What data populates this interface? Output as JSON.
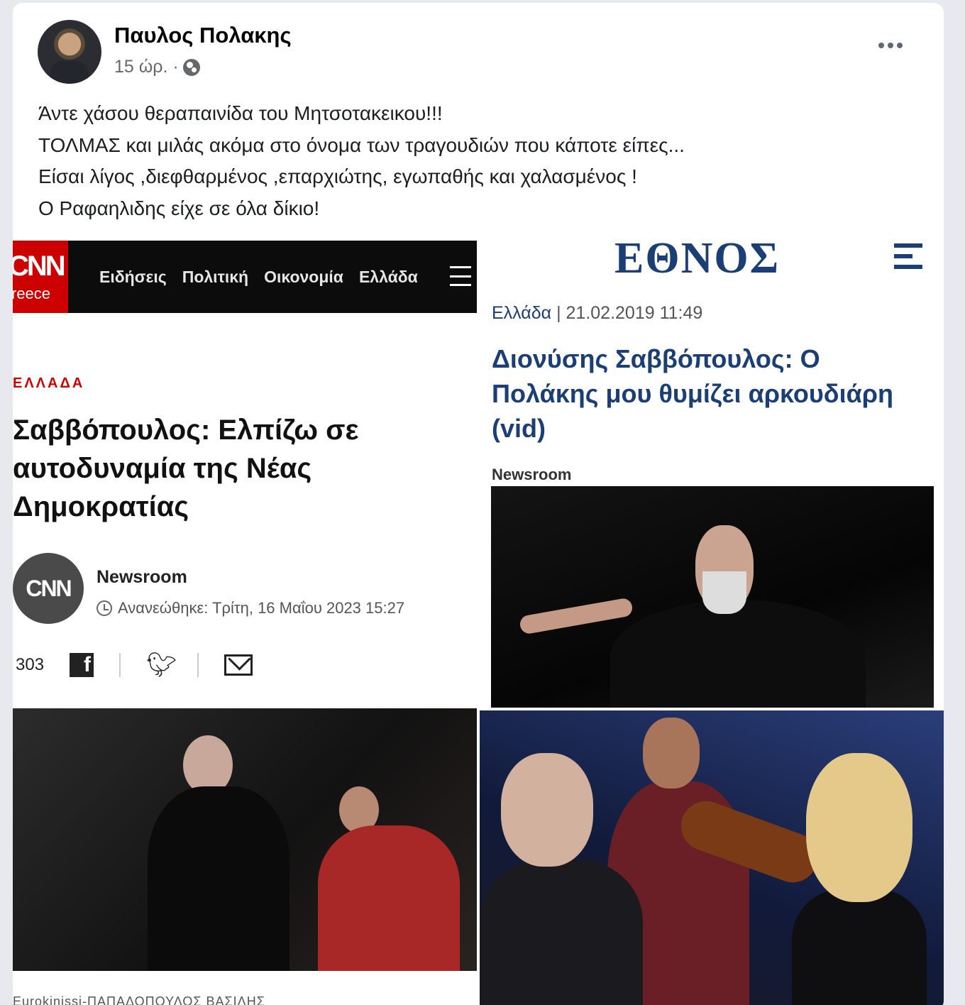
{
  "post": {
    "author": "Παυλος Πολακης",
    "time": "15 ώρ. ·",
    "visibility_icon": "globe-icon",
    "more_icon": "more-icon",
    "text": "Άντε χάσου θεραπαινίδα του Μητσοτακεικου!!!\nΤΟΛΜΑΣ και μιλάς ακόμα στο όνομα των τραγουδιών που κάποτε είπες...\nΕίσαι λίγος ,διεφθαρμένος ,επαρχιώτης, εγωπαθής και χαλασμένος !\nΟ Ραφαηλιδης είχε σε όλα δίκιο!"
  },
  "cnn": {
    "logo_line1": "CNN",
    "logo_line2": "reece",
    "nav": [
      "Ειδήσεις",
      "Πολιτική",
      "Οικονομία",
      "Ελλάδα"
    ],
    "section": "ΕΛΛΑΔΑ",
    "headline": "Σαββόπουλος: Ελπίζω σε αυτοδυναμία της Νέας Δημοκρατίας",
    "author_logo": "CNN",
    "author": "Newsroom",
    "updated": "Ανανεώθηκε: Τρίτη, 16 Μαΐου 2023 15:27",
    "share_count": "303",
    "caption": "Eurokinissi-ΠΑΠΑΔΟΠΟΥΛΟΣ ΒΑΣΙΛΗΣ"
  },
  "ethnos": {
    "logo": "ΕΘΝΟΣ",
    "category": "Ελλάδα",
    "date": " | 21.02.2019 11:49",
    "headline": "Διονύσης Σαββόπουλος: Ο Πολάκης μου θυμίζει αρκουδιάρη (vid)",
    "author": "Newsroom"
  },
  "colors": {
    "cnn_red": "#cc0000",
    "ethnos_blue": "#1b3f74",
    "fb_text": "#1c1e21",
    "fb_meta": "#65676b"
  }
}
